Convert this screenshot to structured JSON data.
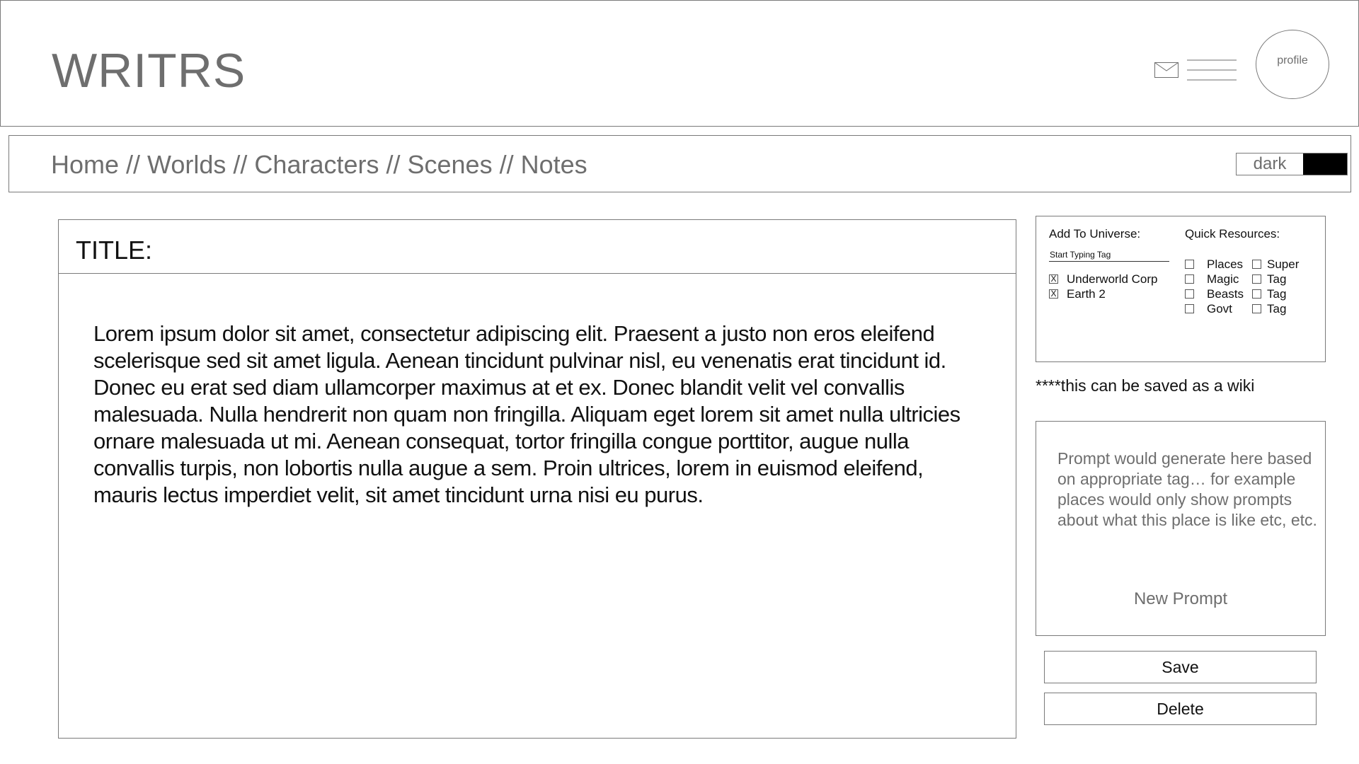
{
  "header": {
    "logo": "WRITRS",
    "icons": {
      "mail": "mail-icon",
      "menu": "menu-icon"
    },
    "profile_label": "profile"
  },
  "nav": {
    "crumbs": [
      "Home",
      "Worlds",
      "Characters",
      "Scenes",
      "Notes"
    ],
    "separator": "//",
    "theme_label": "dark"
  },
  "editor": {
    "title_label": "TITLE:",
    "body": "Lorem ipsum dolor sit amet, consectetur adipiscing elit. Praesent a justo non eros eleifend scelerisque sed sit amet ligula. Aenean tincidunt pulvinar nisl, eu venenatis erat tincidunt id. Donec eu erat sed diam ullamcorper maximus at et ex. Donec blandit velit vel convallis malesuada. Nulla hendrerit non quam non fringilla. Aliquam eget lorem sit amet nulla ultricies ornare malesuada ut mi. Aenean consequat, tortor fringilla congue porttitor, augue nulla convallis turpis, non lobortis nulla augue a sem. Proin ultrices, lorem in euismod eleifend, mauris lectus imperdiet velit, sit amet tincidunt urna nisi eu purus."
  },
  "sidebar": {
    "universe": {
      "heading": "Add To Universe:",
      "input_placeholder": "Start Typing Tag",
      "items": [
        {
          "label": "Underworld Corp",
          "mark": "X",
          "checked": true
        },
        {
          "label": "Earth 2",
          "mark": "X",
          "checked": true
        }
      ]
    },
    "resources": {
      "heading": "Quick Resources:",
      "col1": [
        "Places",
        "Magic",
        "Beasts",
        "Govt"
      ],
      "col2": [
        "Super",
        "Tag",
        "Tag",
        "Tag"
      ]
    },
    "note": "****this can be saved as a wiki",
    "prompt": {
      "text": "Prompt would generate here based on appropriate tag… for example places would only show prompts about what this place is like etc, etc.",
      "new_label": "New Prompt"
    },
    "actions": {
      "save": "Save",
      "delete": "Delete"
    }
  }
}
